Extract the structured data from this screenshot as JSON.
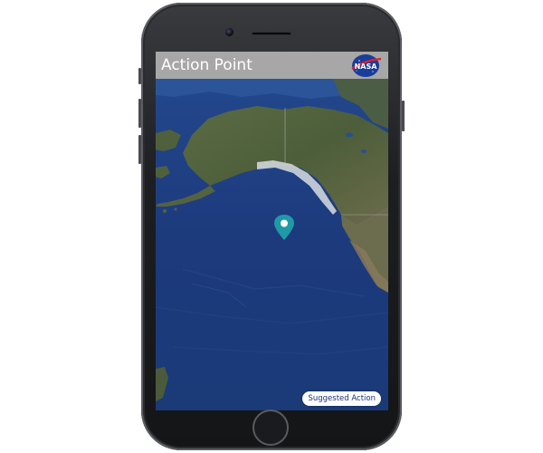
{
  "app": {
    "title": "Action Point",
    "logo_icon": "nasa-logo",
    "logo_text": "NASA",
    "header_background": "#a7a7a7"
  },
  "map": {
    "type": "satellite",
    "marker_icon": "location-pin-icon",
    "marker_color": "#1f9aa6",
    "ocean_color": "#1b3a7a"
  },
  "actions": {
    "suggested_action_label": "Suggested Action"
  }
}
